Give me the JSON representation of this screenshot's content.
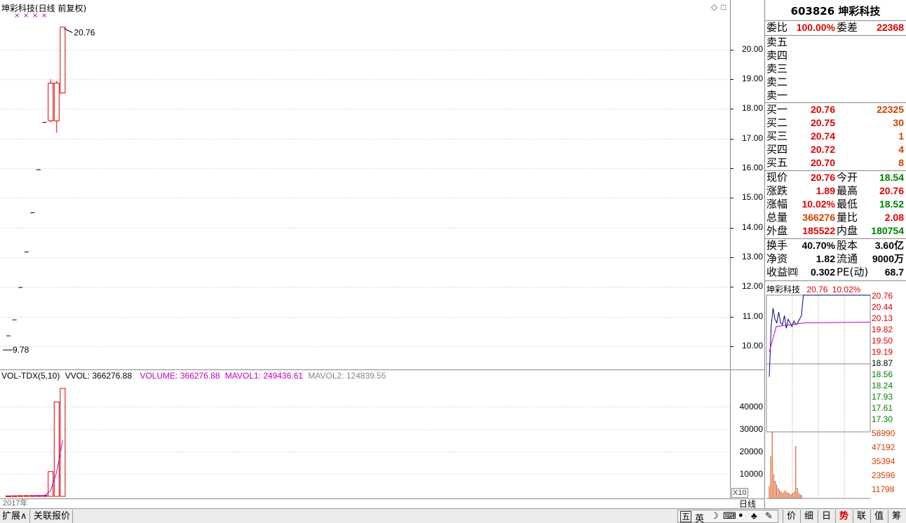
{
  "main_chart": {
    "title": "坤彩科技(日线 前复权)",
    "high_label": "20.76",
    "low_label": "9.78",
    "corner_icons": [
      "◇",
      "□"
    ],
    "price_ticks": [
      "20.00",
      "19.00",
      "18.00",
      "17.00",
      "16.00",
      "15.00",
      "14.00",
      "13.00",
      "12.00",
      "11.00",
      "10.00"
    ]
  },
  "chart_data": {
    "type": "candlestick",
    "ylim": [
      9.5,
      21.2
    ],
    "candles": [
      {
        "open": 10.35,
        "high": 10.35,
        "low": 10.35,
        "close": 10.35
      },
      {
        "open": 10.89,
        "high": 10.89,
        "low": 10.89,
        "close": 10.89
      },
      {
        "open": 11.98,
        "high": 11.98,
        "low": 11.98,
        "close": 11.98
      },
      {
        "open": 13.18,
        "high": 13.18,
        "low": 13.18,
        "close": 13.18
      },
      {
        "open": 14.5,
        "high": 14.5,
        "low": 14.5,
        "close": 14.5
      },
      {
        "open": 15.95,
        "high": 15.95,
        "low": 15.95,
        "close": 15.95
      },
      {
        "open": 17.55,
        "high": 17.55,
        "low": 17.55,
        "close": 17.55
      },
      {
        "open": 17.6,
        "high": 19.0,
        "low": 17.55,
        "close": 18.87
      },
      {
        "open": 18.87,
        "high": 18.95,
        "low": 17.2,
        "close": 17.6
      },
      {
        "open": 18.54,
        "high": 20.76,
        "low": 18.52,
        "close": 20.76
      }
    ],
    "volume": {
      "values": [
        200,
        250,
        300,
        320,
        350,
        380,
        400,
        11000,
        42000,
        48000
      ],
      "bars_hollow": [
        7,
        8,
        9
      ],
      "mavol1": [
        null,
        null,
        null,
        null,
        284,
        320,
        350,
        2490,
        10825,
        24943
      ]
    }
  },
  "vol_chart": {
    "indicator": "VOL-TDX(5,10)",
    "vvol": "VVOL: 366276.88",
    "volume": "VOLUME: 366276.88",
    "mavol1": "MAVOL1: 249436.61",
    "mavol2": "MAVOL2: 124839.55",
    "ticks": [
      "40000",
      "30000",
      "20000",
      "10000"
    ],
    "unit": "X10",
    "year": "2017年"
  },
  "quote": {
    "header": "603826 坤彩科技",
    "weibi_label": "委比",
    "weibi_value": "100.00%",
    "weicha_label": "委差",
    "weicha_value": "22368",
    "sells": [
      {
        "label": "卖五",
        "price": "",
        "vol": ""
      },
      {
        "label": "卖四",
        "price": "",
        "vol": ""
      },
      {
        "label": "卖三",
        "price": "",
        "vol": ""
      },
      {
        "label": "卖二",
        "price": "",
        "vol": ""
      },
      {
        "label": "卖一",
        "price": "",
        "vol": ""
      }
    ],
    "buys": [
      {
        "label": "买一",
        "price": "20.76",
        "vol": "22325"
      },
      {
        "label": "买二",
        "price": "20.75",
        "vol": "30"
      },
      {
        "label": "买三",
        "price": "20.74",
        "vol": "1"
      },
      {
        "label": "买四",
        "price": "20.72",
        "vol": "4"
      },
      {
        "label": "买五",
        "price": "20.70",
        "vol": "8"
      }
    ],
    "stats": [
      {
        "l1": "现价",
        "v1": "20.76",
        "c1": "red",
        "l2": "今开",
        "v2": "18.54",
        "c2": "grn"
      },
      {
        "l1": "涨跌",
        "v1": "1.89",
        "c1": "red",
        "l2": "最高",
        "v2": "20.76",
        "c2": "red"
      },
      {
        "l1": "涨幅",
        "v1": "10.02%",
        "c1": "red",
        "l2": "最低",
        "v2": "18.52",
        "c2": "grn"
      },
      {
        "l1": "总量",
        "v1": "366276",
        "c1": "org",
        "l2": "量比",
        "v2": "2.08",
        "c2": "red"
      },
      {
        "l1": "外盘",
        "v1": "185522",
        "c1": "red",
        "l2": "内盘",
        "v2": "180754",
        "c2": "grn"
      }
    ],
    "fund": [
      {
        "l1": "换手",
        "v1": "40.70%",
        "l2": "股本",
        "v2": "3.60亿"
      },
      {
        "l1": "净资",
        "v1": "1.82",
        "l2": "流通",
        "v2": "9000万"
      },
      {
        "l1": "收益㈣",
        "v1": "0.302",
        "l2": "PE(动)",
        "v2": "68.7"
      }
    ]
  },
  "mini_chart": {
    "name": "坤彩科技",
    "price": "20.76",
    "pct": "10.02%",
    "price_ticks": [
      "20.76",
      "20.44",
      "20.13",
      "19.82",
      "19.50",
      "19.19",
      "18.87",
      "18.56",
      "18.24",
      "17.93",
      "17.61",
      "17.30"
    ],
    "vol_ticks": [
      "58990",
      "47192",
      "35394",
      "23596",
      "11798"
    ]
  },
  "bottom": {
    "tabs": [
      "扩展∧",
      "关联报价"
    ],
    "ime": [
      "五",
      "英",
      "☽",
      "⌨",
      "🎤",
      "♣",
      "✎"
    ],
    "right_tabs": [
      "价",
      "细",
      "日",
      "势",
      "联",
      "值",
      "筹"
    ],
    "period": "日线"
  },
  "colors": {
    "up": "#e00000",
    "down": "#008000",
    "grid": "#b0b0b0",
    "purple": "#c000c0"
  }
}
